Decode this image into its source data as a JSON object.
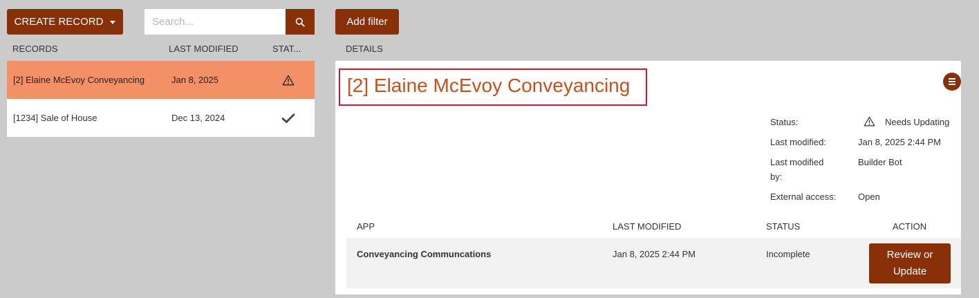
{
  "toolbar": {
    "create_label": "CREATE RECORD",
    "search_placeholder": "Search...",
    "filter_label": "Add filter"
  },
  "records": {
    "headers": {
      "name": "RECORDS",
      "modified": "LAST MODIFIED",
      "status": "STAT..."
    },
    "rows": [
      {
        "name": "[2] Elaine McEvoy Conveyancing",
        "modified": "Jan 8, 2025",
        "status_icon": "warning-icon",
        "selected": true
      },
      {
        "name": "[1234] Sale of House",
        "modified": "Dec 13, 2024",
        "status_icon": "check-icon",
        "selected": false
      }
    ]
  },
  "details": {
    "header": "DETAILS",
    "title": "[2] Elaine McEvoy Conveyancing",
    "status_label": "Status:",
    "status_value": "Needs Updating",
    "last_modified_label": "Last modified:",
    "last_modified_value": "Jan 8, 2025 2:44 PM",
    "last_modified_by_label_1": "Last modified",
    "last_modified_by_label_2": "by:",
    "last_modified_by_value": "Builder Bot",
    "external_access_label": "External access:",
    "external_access_value": "Open",
    "apps": {
      "headers": {
        "app": "APP",
        "modified": "LAST MODIFIED",
        "status": "STATUS",
        "action": "ACTION"
      },
      "rows": [
        {
          "app": "Conveyancing Communcations",
          "modified": "Jan 8, 2025 2:44 PM",
          "status": "Incomplete",
          "action_line1": "Review or",
          "action_line2": "Update"
        }
      ]
    }
  },
  "colors": {
    "brand": "#8a3008",
    "selected_row": "#f49066",
    "title": "#c8501a",
    "highlight_border": "#c51b2f"
  }
}
